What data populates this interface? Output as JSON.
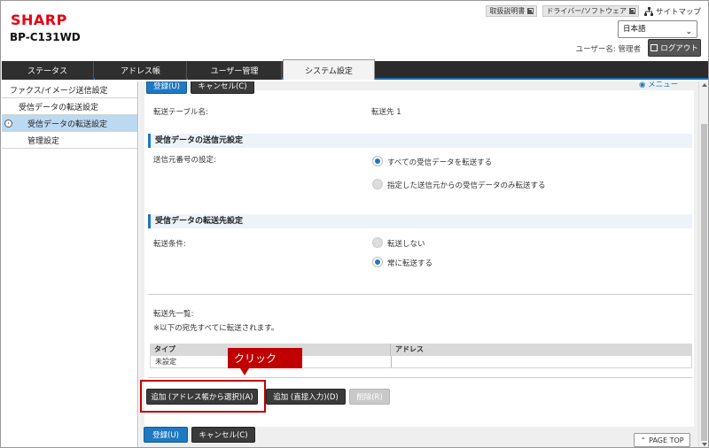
{
  "header": {
    "brand": "SHARP",
    "model": "BP-C131WD",
    "links": {
      "manual": "取扱説明書",
      "driver": "ドライバー/ソフトウェア",
      "sitemap": "サイトマップ"
    },
    "language": "日本語",
    "user_label": "ユーザー名: 管理者",
    "logout": "ログアウト"
  },
  "tabs": [
    "ステータス",
    "アドレス帳",
    "ユーザー管理",
    "システム設定"
  ],
  "sidebar": {
    "items": [
      {
        "label": "ファクス/イメージ送信設定"
      },
      {
        "label": "受信データの転送設定"
      },
      {
        "label": "受信データの転送設定"
      },
      {
        "label": "管理設定"
      }
    ]
  },
  "main": {
    "top_buttons": {
      "register": "登録(U)",
      "cancel": "キャンセル(C)"
    },
    "menu_link": "メニュー",
    "table_name_label": "転送テーブル名:",
    "table_name_value": "転送先 1",
    "section1": {
      "title": "受信データの送信元設定",
      "field_label": "送信元番号の設定:",
      "options": [
        "すべての受信データを転送する",
        "指定した送信元からの受信データのみ転送する"
      ]
    },
    "section2": {
      "title": "受信データの転送先設定",
      "field_label": "転送条件:",
      "options": [
        "転送しない",
        "常に転送する"
      ]
    },
    "dest_list_label": "転送先一覧:",
    "dest_note": "※以下の宛先すべてに転送されます。",
    "table": {
      "headers": [
        "タイプ",
        "アドレス"
      ],
      "rows": [
        [
          "未設定",
          ""
        ]
      ]
    },
    "action_buttons": {
      "add_from_address_book": "追加 (アドレス帳から選択)(A)",
      "add_direct": "追加 (直接入力)(D)",
      "delete": "削除(R)"
    },
    "callout": "クリック",
    "bottom_buttons": {
      "register": "登録(U)",
      "cancel": "キャンセル(C)"
    },
    "page_top": "PAGE TOP"
  },
  "colors": {
    "brand": "#e60012",
    "accent": "#1e78c2",
    "callout": "#c00000"
  }
}
